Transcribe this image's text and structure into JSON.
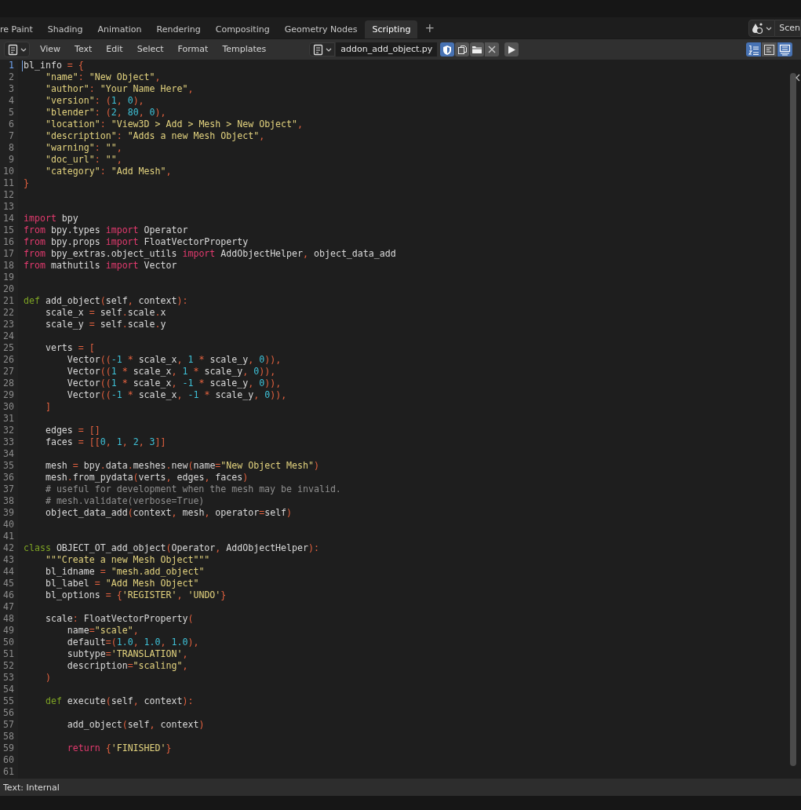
{
  "workspace_tabs": [
    {
      "label": "re Paint",
      "selected": false
    },
    {
      "label": "Shading",
      "selected": false
    },
    {
      "label": "Animation",
      "selected": false
    },
    {
      "label": "Rendering",
      "selected": false
    },
    {
      "label": "Compositing",
      "selected": false
    },
    {
      "label": "Geometry Nodes",
      "selected": false
    },
    {
      "label": "Scripting",
      "selected": true
    }
  ],
  "add_tab": "+",
  "scene_selector": {
    "label": "Scen"
  },
  "header": {
    "menus": [
      "View",
      "Text",
      "Edit",
      "Select",
      "Format",
      "Templates"
    ],
    "text_name": "addon_add_object.py",
    "fake_user": true,
    "toggles": [
      {
        "kind": "line_numbers",
        "on": true
      },
      {
        "kind": "word_wrap",
        "on": false
      },
      {
        "kind": "syntax_highlight",
        "on": true
      }
    ]
  },
  "lines": [
    {
      "number": "1",
      "current": true,
      "tokens": [
        {
          "text": "bl_info ",
          "kind": "plain"
        },
        {
          "text": "= {",
          "kind": "symbol"
        }
      ]
    },
    {
      "number": "2",
      "current": false,
      "tokens": [
        {
          "text": "    \"name\"",
          "kind": "string"
        },
        {
          "text": ": ",
          "kind": "symbol"
        },
        {
          "text": "\"New Object\"",
          "kind": "string"
        },
        {
          "text": ",",
          "kind": "symbol"
        }
      ]
    },
    {
      "number": "3",
      "current": false,
      "tokens": [
        {
          "text": "    \"author\"",
          "kind": "string"
        },
        {
          "text": ": ",
          "kind": "symbol"
        },
        {
          "text": "\"Your Name Here\"",
          "kind": "string"
        },
        {
          "text": ",",
          "kind": "symbol"
        }
      ]
    },
    {
      "number": "4",
      "current": false,
      "tokens": [
        {
          "text": "    \"version\"",
          "kind": "string"
        },
        {
          "text": ": (",
          "kind": "symbol"
        },
        {
          "text": "1",
          "kind": "number"
        },
        {
          "text": ", ",
          "kind": "symbol"
        },
        {
          "text": "0",
          "kind": "number"
        },
        {
          "text": "),",
          "kind": "symbol"
        }
      ]
    },
    {
      "number": "5",
      "current": false,
      "tokens": [
        {
          "text": "    \"blender\"",
          "kind": "string"
        },
        {
          "text": ": (",
          "kind": "symbol"
        },
        {
          "text": "2",
          "kind": "number"
        },
        {
          "text": ", ",
          "kind": "symbol"
        },
        {
          "text": "80",
          "kind": "number"
        },
        {
          "text": ", ",
          "kind": "symbol"
        },
        {
          "text": "0",
          "kind": "number"
        },
        {
          "text": "),",
          "kind": "symbol"
        }
      ]
    },
    {
      "number": "6",
      "current": false,
      "tokens": [
        {
          "text": "    \"location\"",
          "kind": "string"
        },
        {
          "text": ": ",
          "kind": "symbol"
        },
        {
          "text": "\"View3D > Add > Mesh > New Object\"",
          "kind": "string"
        },
        {
          "text": ",",
          "kind": "symbol"
        }
      ]
    },
    {
      "number": "7",
      "current": false,
      "tokens": [
        {
          "text": "    \"description\"",
          "kind": "string"
        },
        {
          "text": ": ",
          "kind": "symbol"
        },
        {
          "text": "\"Adds a new Mesh Object\"",
          "kind": "string"
        },
        {
          "text": ",",
          "kind": "symbol"
        }
      ]
    },
    {
      "number": "8",
      "current": false,
      "tokens": [
        {
          "text": "    \"warning\"",
          "kind": "string"
        },
        {
          "text": ": ",
          "kind": "symbol"
        },
        {
          "text": "\"\"",
          "kind": "string"
        },
        {
          "text": ",",
          "kind": "symbol"
        }
      ]
    },
    {
      "number": "9",
      "current": false,
      "tokens": [
        {
          "text": "    \"doc_url\"",
          "kind": "string"
        },
        {
          "text": ": ",
          "kind": "symbol"
        },
        {
          "text": "\"\"",
          "kind": "string"
        },
        {
          "text": ",",
          "kind": "symbol"
        }
      ]
    },
    {
      "number": "10",
      "current": false,
      "tokens": [
        {
          "text": "    \"category\"",
          "kind": "string"
        },
        {
          "text": ": ",
          "kind": "symbol"
        },
        {
          "text": "\"Add Mesh\"",
          "kind": "string"
        },
        {
          "text": ",",
          "kind": "symbol"
        }
      ]
    },
    {
      "number": "11",
      "current": false,
      "tokens": [
        {
          "text": "}",
          "kind": "symbol"
        }
      ]
    },
    {
      "number": "12",
      "current": false
    },
    {
      "number": "13",
      "current": false
    },
    {
      "number": "14",
      "current": false,
      "tokens": [
        {
          "text": "import",
          "kind": "keyword"
        },
        {
          "text": " bpy",
          "kind": "plain"
        }
      ]
    },
    {
      "number": "15",
      "current": false,
      "tokens": [
        {
          "text": "from",
          "kind": "keyword"
        },
        {
          "text": " bpy.types ",
          "kind": "plain"
        },
        {
          "text": "import",
          "kind": "keyword"
        },
        {
          "text": " Operator",
          "kind": "plain"
        }
      ]
    },
    {
      "number": "16",
      "current": false,
      "tokens": [
        {
          "text": "from",
          "kind": "keyword"
        },
        {
          "text": " bpy.props ",
          "kind": "plain"
        },
        {
          "text": "import",
          "kind": "keyword"
        },
        {
          "text": " FloatVectorProperty",
          "kind": "plain"
        }
      ]
    },
    {
      "number": "17",
      "current": false,
      "tokens": [
        {
          "text": "from",
          "kind": "keyword"
        },
        {
          "text": " bpy_extras.object_utils ",
          "kind": "plain"
        },
        {
          "text": "import",
          "kind": "keyword"
        },
        {
          "text": " AddObjectHelper",
          "kind": "plain"
        },
        {
          "text": ", ",
          "kind": "symbol"
        },
        {
          "text": "object_data_add",
          "kind": "plain"
        }
      ]
    },
    {
      "number": "18",
      "current": false,
      "tokens": [
        {
          "text": "from",
          "kind": "keyword"
        },
        {
          "text": " mathutils ",
          "kind": "plain"
        },
        {
          "text": "import",
          "kind": "keyword"
        },
        {
          "text": " Vector",
          "kind": "plain"
        }
      ]
    },
    {
      "number": "19",
      "current": false
    },
    {
      "number": "20",
      "current": false
    },
    {
      "number": "21",
      "current": false,
      "tokens": [
        {
          "text": "def",
          "kind": "decl"
        },
        {
          "text": " add_object",
          "kind": "plain"
        },
        {
          "text": "(",
          "kind": "symbol"
        },
        {
          "text": "self",
          "kind": "plain"
        },
        {
          "text": ", ",
          "kind": "symbol"
        },
        {
          "text": "context",
          "kind": "plain"
        },
        {
          "text": "):",
          "kind": "symbol"
        }
      ]
    },
    {
      "number": "22",
      "current": false,
      "tokens": [
        {
          "text": "    scale_x ",
          "kind": "plain"
        },
        {
          "text": "=",
          "kind": "symbol"
        },
        {
          "text": " self",
          "kind": "plain"
        },
        {
          "text": ".",
          "kind": "symbol"
        },
        {
          "text": "scale",
          "kind": "plain"
        },
        {
          "text": ".",
          "kind": "symbol"
        },
        {
          "text": "x",
          "kind": "plain"
        }
      ]
    },
    {
      "number": "23",
      "current": false,
      "tokens": [
        {
          "text": "    scale_y ",
          "kind": "plain"
        },
        {
          "text": "=",
          "kind": "symbol"
        },
        {
          "text": " self",
          "kind": "plain"
        },
        {
          "text": ".",
          "kind": "symbol"
        },
        {
          "text": "scale",
          "kind": "plain"
        },
        {
          "text": ".",
          "kind": "symbol"
        },
        {
          "text": "y",
          "kind": "plain"
        }
      ]
    },
    {
      "number": "24",
      "current": false
    },
    {
      "number": "25",
      "current": false,
      "tokens": [
        {
          "text": "    verts ",
          "kind": "plain"
        },
        {
          "text": "= [",
          "kind": "symbol"
        }
      ]
    },
    {
      "number": "26",
      "current": false,
      "tokens": [
        {
          "text": "        Vector",
          "kind": "plain"
        },
        {
          "text": "((",
          "kind": "symbol"
        },
        {
          "text": "-1",
          "kind": "number"
        },
        {
          "text": " * ",
          "kind": "symbol"
        },
        {
          "text": "scale_x",
          "kind": "plain"
        },
        {
          "text": ", ",
          "kind": "symbol"
        },
        {
          "text": "1",
          "kind": "number"
        },
        {
          "text": " * ",
          "kind": "symbol"
        },
        {
          "text": "scale_y",
          "kind": "plain"
        },
        {
          "text": ", ",
          "kind": "symbol"
        },
        {
          "text": "0",
          "kind": "number"
        },
        {
          "text": ")),",
          "kind": "symbol"
        }
      ]
    },
    {
      "number": "27",
      "current": false,
      "tokens": [
        {
          "text": "        Vector",
          "kind": "plain"
        },
        {
          "text": "((",
          "kind": "symbol"
        },
        {
          "text": "1",
          "kind": "number"
        },
        {
          "text": " * ",
          "kind": "symbol"
        },
        {
          "text": "scale_x",
          "kind": "plain"
        },
        {
          "text": ", ",
          "kind": "symbol"
        },
        {
          "text": "1",
          "kind": "number"
        },
        {
          "text": " * ",
          "kind": "symbol"
        },
        {
          "text": "scale_y",
          "kind": "plain"
        },
        {
          "text": ", ",
          "kind": "symbol"
        },
        {
          "text": "0",
          "kind": "number"
        },
        {
          "text": ")),",
          "kind": "symbol"
        }
      ]
    },
    {
      "number": "28",
      "current": false,
      "tokens": [
        {
          "text": "        Vector",
          "kind": "plain"
        },
        {
          "text": "((",
          "kind": "symbol"
        },
        {
          "text": "1",
          "kind": "number"
        },
        {
          "text": " * ",
          "kind": "symbol"
        },
        {
          "text": "scale_x",
          "kind": "plain"
        },
        {
          "text": ", ",
          "kind": "symbol"
        },
        {
          "text": "-1",
          "kind": "number"
        },
        {
          "text": " * ",
          "kind": "symbol"
        },
        {
          "text": "scale_y",
          "kind": "plain"
        },
        {
          "text": ", ",
          "kind": "symbol"
        },
        {
          "text": "0",
          "kind": "number"
        },
        {
          "text": ")),",
          "kind": "symbol"
        }
      ]
    },
    {
      "number": "29",
      "current": false,
      "tokens": [
        {
          "text": "        Vector",
          "kind": "plain"
        },
        {
          "text": "((",
          "kind": "symbol"
        },
        {
          "text": "-1",
          "kind": "number"
        },
        {
          "text": " * ",
          "kind": "symbol"
        },
        {
          "text": "scale_x",
          "kind": "plain"
        },
        {
          "text": ", ",
          "kind": "symbol"
        },
        {
          "text": "-1",
          "kind": "number"
        },
        {
          "text": " * ",
          "kind": "symbol"
        },
        {
          "text": "scale_y",
          "kind": "plain"
        },
        {
          "text": ", ",
          "kind": "symbol"
        },
        {
          "text": "0",
          "kind": "number"
        },
        {
          "text": ")),",
          "kind": "symbol"
        }
      ]
    },
    {
      "number": "30",
      "current": false,
      "tokens": [
        {
          "text": "    ]",
          "kind": "symbol"
        }
      ]
    },
    {
      "number": "31",
      "current": false
    },
    {
      "number": "32",
      "current": false,
      "tokens": [
        {
          "text": "    edges ",
          "kind": "plain"
        },
        {
          "text": "= []",
          "kind": "symbol"
        }
      ]
    },
    {
      "number": "33",
      "current": false,
      "tokens": [
        {
          "text": "    faces ",
          "kind": "plain"
        },
        {
          "text": "= [[",
          "kind": "symbol"
        },
        {
          "text": "0",
          "kind": "number"
        },
        {
          "text": ", ",
          "kind": "symbol"
        },
        {
          "text": "1",
          "kind": "number"
        },
        {
          "text": ", ",
          "kind": "symbol"
        },
        {
          "text": "2",
          "kind": "number"
        },
        {
          "text": ", ",
          "kind": "symbol"
        },
        {
          "text": "3",
          "kind": "number"
        },
        {
          "text": "]]",
          "kind": "symbol"
        }
      ]
    },
    {
      "number": "34",
      "current": false
    },
    {
      "number": "35",
      "current": false,
      "tokens": [
        {
          "text": "    mesh ",
          "kind": "plain"
        },
        {
          "text": "=",
          "kind": "symbol"
        },
        {
          "text": " bpy",
          "kind": "plain"
        },
        {
          "text": ".",
          "kind": "symbol"
        },
        {
          "text": "data",
          "kind": "plain"
        },
        {
          "text": ".",
          "kind": "symbol"
        },
        {
          "text": "meshes",
          "kind": "plain"
        },
        {
          "text": ".",
          "kind": "symbol"
        },
        {
          "text": "new",
          "kind": "plain"
        },
        {
          "text": "(",
          "kind": "symbol"
        },
        {
          "text": "name",
          "kind": "plain"
        },
        {
          "text": "=",
          "kind": "symbol"
        },
        {
          "text": "\"New Object Mesh\"",
          "kind": "string"
        },
        {
          "text": ")",
          "kind": "symbol"
        }
      ]
    },
    {
      "number": "36",
      "current": false,
      "tokens": [
        {
          "text": "    mesh",
          "kind": "plain"
        },
        {
          "text": ".",
          "kind": "symbol"
        },
        {
          "text": "from_pydata",
          "kind": "plain"
        },
        {
          "text": "(",
          "kind": "symbol"
        },
        {
          "text": "verts",
          "kind": "plain"
        },
        {
          "text": ", ",
          "kind": "symbol"
        },
        {
          "text": "edges",
          "kind": "plain"
        },
        {
          "text": ", ",
          "kind": "symbol"
        },
        {
          "text": "faces",
          "kind": "plain"
        },
        {
          "text": ")",
          "kind": "symbol"
        }
      ]
    },
    {
      "number": "37",
      "current": false,
      "tokens": [
        {
          "text": "    # useful for development when the mesh may be invalid.",
          "kind": "comment"
        }
      ]
    },
    {
      "number": "38",
      "current": false,
      "tokens": [
        {
          "text": "    # mesh.validate(verbose=True)",
          "kind": "comment"
        }
      ]
    },
    {
      "number": "39",
      "current": false,
      "tokens": [
        {
          "text": "    object_data_add",
          "kind": "plain"
        },
        {
          "text": "(",
          "kind": "symbol"
        },
        {
          "text": "context",
          "kind": "plain"
        },
        {
          "text": ", ",
          "kind": "symbol"
        },
        {
          "text": "mesh",
          "kind": "plain"
        },
        {
          "text": ", ",
          "kind": "symbol"
        },
        {
          "text": "operator",
          "kind": "plain"
        },
        {
          "text": "=",
          "kind": "symbol"
        },
        {
          "text": "self",
          "kind": "plain"
        },
        {
          "text": ")",
          "kind": "symbol"
        }
      ]
    },
    {
      "number": "40",
      "current": false
    },
    {
      "number": "41",
      "current": false
    },
    {
      "number": "42",
      "current": false,
      "tokens": [
        {
          "text": "class",
          "kind": "decl"
        },
        {
          "text": " OBJECT_OT_add_object",
          "kind": "plain"
        },
        {
          "text": "(",
          "kind": "symbol"
        },
        {
          "text": "Operator",
          "kind": "plain"
        },
        {
          "text": ", ",
          "kind": "symbol"
        },
        {
          "text": "AddObjectHelper",
          "kind": "plain"
        },
        {
          "text": "):",
          "kind": "symbol"
        }
      ]
    },
    {
      "number": "43",
      "current": false,
      "tokens": [
        {
          "text": "    \"\"\"Create a new Mesh Object\"\"\"",
          "kind": "string"
        }
      ]
    },
    {
      "number": "44",
      "current": false,
      "tokens": [
        {
          "text": "    bl_idname ",
          "kind": "plain"
        },
        {
          "text": "= ",
          "kind": "symbol"
        },
        {
          "text": "\"mesh.add_object\"",
          "kind": "string"
        }
      ]
    },
    {
      "number": "45",
      "current": false,
      "tokens": [
        {
          "text": "    bl_label ",
          "kind": "plain"
        },
        {
          "text": "= ",
          "kind": "symbol"
        },
        {
          "text": "\"Add Mesh Object\"",
          "kind": "string"
        }
      ]
    },
    {
      "number": "46",
      "current": false,
      "tokens": [
        {
          "text": "    bl_options ",
          "kind": "plain"
        },
        {
          "text": "= {",
          "kind": "symbol"
        },
        {
          "text": "'REGISTER'",
          "kind": "string"
        },
        {
          "text": ", ",
          "kind": "symbol"
        },
        {
          "text": "'UNDO'",
          "kind": "string"
        },
        {
          "text": "}",
          "kind": "symbol"
        }
      ]
    },
    {
      "number": "47",
      "current": false
    },
    {
      "number": "48",
      "current": false,
      "tokens": [
        {
          "text": "    scale",
          "kind": "plain"
        },
        {
          "text": ": ",
          "kind": "symbol"
        },
        {
          "text": "FloatVectorProperty",
          "kind": "plain"
        },
        {
          "text": "(",
          "kind": "symbol"
        }
      ]
    },
    {
      "number": "49",
      "current": false,
      "tokens": [
        {
          "text": "        name",
          "kind": "plain"
        },
        {
          "text": "=",
          "kind": "symbol"
        },
        {
          "text": "\"scale\"",
          "kind": "string"
        },
        {
          "text": ",",
          "kind": "symbol"
        }
      ]
    },
    {
      "number": "50",
      "current": false,
      "tokens": [
        {
          "text": "        default",
          "kind": "plain"
        },
        {
          "text": "=(",
          "kind": "symbol"
        },
        {
          "text": "1.0",
          "kind": "number"
        },
        {
          "text": ", ",
          "kind": "symbol"
        },
        {
          "text": "1.0",
          "kind": "number"
        },
        {
          "text": ", ",
          "kind": "symbol"
        },
        {
          "text": "1.0",
          "kind": "number"
        },
        {
          "text": "),",
          "kind": "symbol"
        }
      ]
    },
    {
      "number": "51",
      "current": false,
      "tokens": [
        {
          "text": "        subtype",
          "kind": "plain"
        },
        {
          "text": "=",
          "kind": "symbol"
        },
        {
          "text": "'TRANSLATION'",
          "kind": "string"
        },
        {
          "text": ",",
          "kind": "symbol"
        }
      ]
    },
    {
      "number": "52",
      "current": false,
      "tokens": [
        {
          "text": "        description",
          "kind": "plain"
        },
        {
          "text": "=",
          "kind": "symbol"
        },
        {
          "text": "\"scaling\"",
          "kind": "string"
        },
        {
          "text": ",",
          "kind": "symbol"
        }
      ]
    },
    {
      "number": "53",
      "current": false,
      "tokens": [
        {
          "text": "    )",
          "kind": "symbol"
        }
      ]
    },
    {
      "number": "54",
      "current": false
    },
    {
      "number": "55",
      "current": false,
      "tokens": [
        {
          "text": "    def",
          "kind": "decl"
        },
        {
          "text": " execute",
          "kind": "plain"
        },
        {
          "text": "(",
          "kind": "symbol"
        },
        {
          "text": "self",
          "kind": "plain"
        },
        {
          "text": ", ",
          "kind": "symbol"
        },
        {
          "text": "context",
          "kind": "plain"
        },
        {
          "text": "):",
          "kind": "symbol"
        }
      ]
    },
    {
      "number": "56",
      "current": false
    },
    {
      "number": "57",
      "current": false,
      "tokens": [
        {
          "text": "        add_object",
          "kind": "plain"
        },
        {
          "text": "(",
          "kind": "symbol"
        },
        {
          "text": "self",
          "kind": "plain"
        },
        {
          "text": ", ",
          "kind": "symbol"
        },
        {
          "text": "context",
          "kind": "plain"
        },
        {
          "text": ")",
          "kind": "symbol"
        }
      ]
    },
    {
      "number": "58",
      "current": false
    },
    {
      "number": "59",
      "current": false,
      "tokens": [
        {
          "text": "        return",
          "kind": "keyword"
        },
        {
          "text": " {",
          "kind": "symbol"
        },
        {
          "text": "'FINISHED'",
          "kind": "string"
        },
        {
          "text": "}",
          "kind": "symbol"
        }
      ]
    },
    {
      "number": "60",
      "current": false
    },
    {
      "number": "61",
      "current": false
    }
  ],
  "status_bar": {
    "text": "Text: Internal"
  }
}
